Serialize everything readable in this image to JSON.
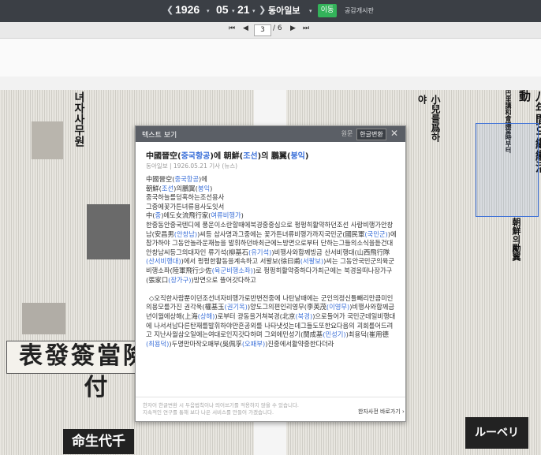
{
  "topbar": {
    "year": "1926",
    "month": "05",
    "day": "21",
    "paper": "동아일보",
    "go_label": "이동",
    "notice_label": "공감개시판"
  },
  "pagebar": {
    "current": "3",
    "total": "/ 6"
  },
  "newspaper": {
    "left_ad": "表發簽當險保付",
    "bottom_ad_left": "命生代千",
    "bottom_ad_right": "ルーベリ",
    "right_headline": "八年間의繼續活動",
    "right_headline2": "巴里講和會議當時부터",
    "mid_headline": "朝鮮의勵翼",
    "small_headline": "小兒를爲하야"
  },
  "popup": {
    "title": "텍스트 보기",
    "tab_original": "원문",
    "tab_korean": "한글변환",
    "close": "✕",
    "article_title_parts": [
      "中國晉空(",
      "중국항공",
      ")에 朝鮮(",
      "조선",
      ")의 鵬翼(",
      "붕익",
      ")"
    ],
    "meta": "동아일보 | 1926.05.21 기사 (뉴스)",
    "body_lines": [
      [
        {
          "t": "中國晉空("
        },
        {
          "t": "중국항공",
          "b": 1
        },
        {
          "t": ")에"
        }
      ],
      [
        {
          "t": "朝鮮("
        },
        {
          "t": "조선",
          "b": 1
        },
        {
          "t": ")의鵬翼("
        },
        {
          "t": "붕익",
          "b": 1
        },
        {
          "t": ")"
        }
      ],
      [
        {
          "t": "중국하늘를덩혹하는조선용사"
        }
      ],
      [
        {
          "t": "그중에꽃가튼녀류용사도잇서"
        }
      ],
      [
        {
          "t": "中("
        },
        {
          "t": "중",
          "b": 1
        },
        {
          "t": ")에도女流飛行家("
        },
        {
          "t": "여류비행가",
          "b": 1
        },
        {
          "t": ")"
        }
      ]
    ],
    "body_para1": [
      {
        "t": "한중동안중국텐디에 풍운이소란할때에북경중중심으로 펑펑히활약하던조선 사람비행가안창남(安昌男"
      },
      {
        "t": "(안창남)",
        "b": 1
      },
      {
        "t": ")씨등 삽사명과그중에는 꽃가튼녀류비행가까지국민군(國民軍"
      },
      {
        "t": "(국민군)",
        "b": 1
      },
      {
        "t": ")에참가하야 그동안놀라운재능을 발휘하던바최근에느방면으로부터 단하는그들의소식을듣건대 안창남씨등그의대자인 류기석(柳基石"
      },
      {
        "t": "(유기석)",
        "b": 1
      },
      {
        "t": ")비행사와합께빙금 산서비행대(山西飛行隊"
      },
      {
        "t": "(산서비행대)",
        "b": 1
      },
      {
        "t": ")에서 펑펑한활동을계속하고 서왈보(徐曰甫"
      },
      {
        "t": "(서왈보)",
        "b": 1
      },
      {
        "t": ")씨는 그동안국민군의육군비행소좌(陸軍飛行少佐"
      },
      {
        "t": "(육군비행소좌)",
        "b": 1
      },
      {
        "t": ")로 펑펑히활약중하다가최근에는 북경을떠나장가구(張家口"
      },
      {
        "t": "(장가구)",
        "b": 1
      },
      {
        "t": ")방면으로 뜰어갓다하고"
      }
    ],
    "body_para2": [
      {
        "t": "◇오직한사람뿐이던조선녀자비행가로반변전중에 나탄날때에는 군인의정신틀빼리만큼미인의용모를가진 권각욱(權基玉"
      },
      {
        "t": "(권기옥)",
        "b": 1
      },
      {
        "t": ")양도그의편인리영무(李英茂"
      },
      {
        "t": "(이영무)",
        "b": 1
      },
      {
        "t": ")비행사와함께금년이월에상해(上海"
      },
      {
        "t": "(상해)",
        "b": 1
      },
      {
        "t": ")로부터 광동을거쳐북경(北京"
      },
      {
        "t": "(북경)",
        "b": 1
      },
      {
        "t": ")으로들어가 국민군데일비행대에 나서서남다른탄재를발휘하야만흔공외를 나타냇섯는데그들도또한요다음의 괴회를어드려고 지난사월삼오일에는여대로인지갓다하며 그외에민성기(閔成基"
      },
      {
        "t": "(민성기)",
        "b": 1
      },
      {
        "t": ")최용덕(崔用德"
      },
      {
        "t": "(최용덕)",
        "b": 1
      },
      {
        "t": ")두명만마작오패부(吳佩孚"
      },
      {
        "t": "(오패부)",
        "b": 1
      },
      {
        "t": ")진중에서활약중한다더라"
      }
    ],
    "footer_note": "한자어 한글변환 시 두음법칙이나 띄어쓰기를 적용하지 않을 수 있습니다.\n지속적인 연구를 통해 보다 나은 서비스를 만들어 가겠습니다.",
    "footer_link": "한자사전 바로가기 ›"
  },
  "colors": {
    "topbar": "#3b3f45",
    "go_button": "#33b35a",
    "accent_blue": "#3a6fd8"
  }
}
